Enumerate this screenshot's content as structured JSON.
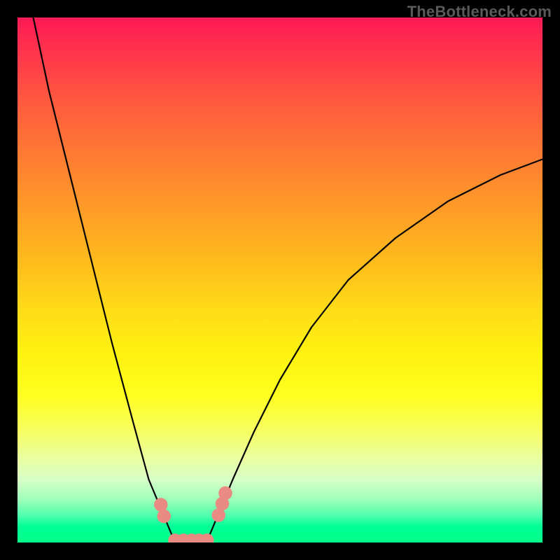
{
  "watermark": "TheBottleneck.com",
  "colors": {
    "frame": "#000000",
    "curve": "#000000",
    "marker": "#e98b83",
    "gradient_top": "#ff1a55",
    "gradient_bottom": "#00ff88"
  },
  "chart_data": {
    "type": "line",
    "title": "",
    "xlabel": "",
    "ylabel": "",
    "xlim": [
      0,
      100
    ],
    "ylim": [
      0,
      100
    ],
    "grid": false,
    "legend": false,
    "series": [
      {
        "name": "left-arm",
        "x": [
          3,
          6,
          10,
          14,
          18,
          22,
          25,
          27.5,
          29,
          30
        ],
        "y": [
          100,
          86,
          70,
          54,
          38,
          23,
          12,
          6,
          2.4,
          0
        ]
      },
      {
        "name": "right-arm",
        "x": [
          36,
          37,
          38.5,
          41,
          45,
          50,
          56,
          63,
          72,
          82,
          92,
          100
        ],
        "y": [
          0,
          2.4,
          6,
          12,
          21,
          31,
          41,
          50,
          58,
          65,
          70,
          73
        ]
      },
      {
        "name": "valley-floor",
        "x": [
          30,
          33,
          36
        ],
        "y": [
          0,
          0,
          0
        ]
      }
    ],
    "markers": [
      {
        "x": 27.3,
        "y": 7.2
      },
      {
        "x": 27.9,
        "y": 5.0
      },
      {
        "x": 30.0,
        "y": 0.4
      },
      {
        "x": 31.6,
        "y": 0.4
      },
      {
        "x": 33.2,
        "y": 0.4
      },
      {
        "x": 34.6,
        "y": 0.4
      },
      {
        "x": 36.1,
        "y": 0.4
      },
      {
        "x": 38.3,
        "y": 5.2
      },
      {
        "x": 39.0,
        "y": 7.4
      },
      {
        "x": 39.6,
        "y": 9.4
      }
    ],
    "marker_radius": 1.3
  }
}
